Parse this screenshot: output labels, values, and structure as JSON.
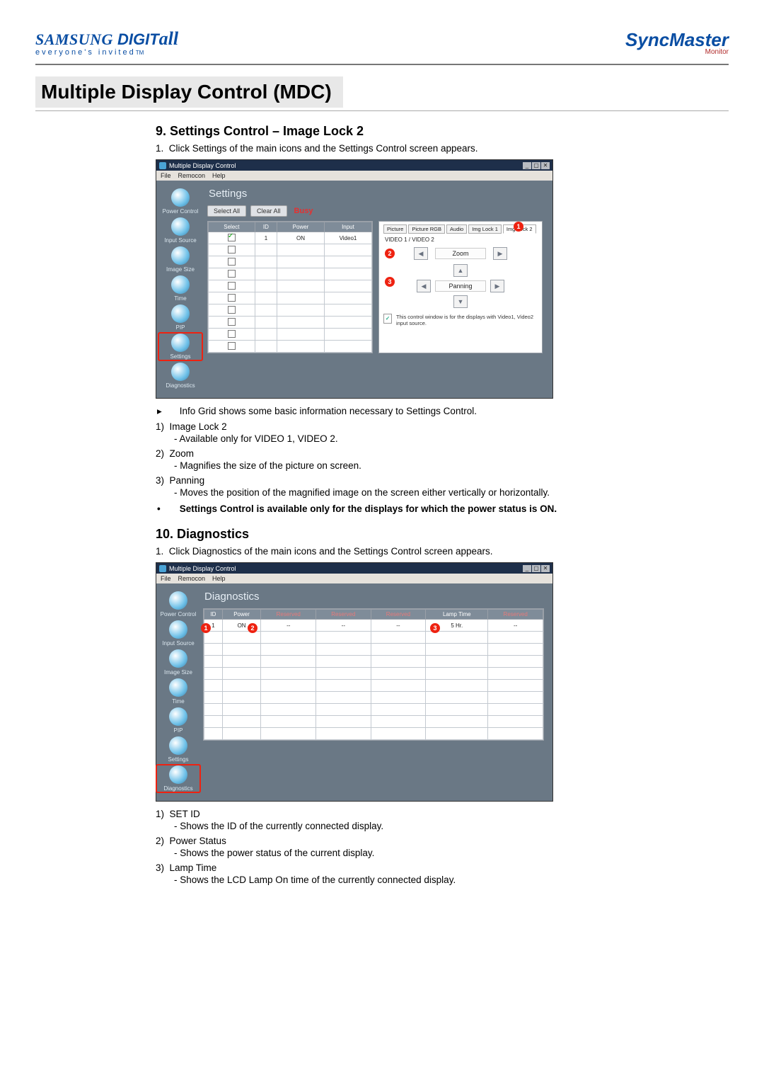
{
  "brand": {
    "left_prefix": "SAMSUNG",
    "left_mid": " DIGIT",
    "left_suffix": "all",
    "tagline": "everyone's invited",
    "tagline_tm": "TM",
    "right_main": "SyncMaster",
    "right_sub": "Monitor"
  },
  "page_title": "Multiple Display Control (MDC)",
  "section9": {
    "heading": "9. Settings Control – Image Lock 2",
    "intro_num": "1.",
    "intro_text": "Click Settings of the main icons and the Settings Control screen appears.",
    "info_line": "Info Grid shows some basic information necessary to Settings Control.",
    "items": [
      {
        "n": "1)",
        "title": "Image Lock 2",
        "desc": "- Available only for VIDEO 1, VIDEO 2."
      },
      {
        "n": "2)",
        "title": "Zoom",
        "desc": "- Magnifies the size of the picture on screen."
      },
      {
        "n": "3)",
        "title": "Panning",
        "desc": "- Moves the position of the magnified image on the screen either vertically or horizontally."
      }
    ],
    "bold_note": "Settings Control is available only for the displays for which the power status is ON."
  },
  "shot1": {
    "titlebar": "Multiple Display Control",
    "menu": [
      "File",
      "Remocon",
      "Help"
    ],
    "sidebar": [
      "Power Control",
      "Input Source",
      "Image Size",
      "Time",
      "PIP",
      "Settings",
      "Diagnostics"
    ],
    "selected_sidebar_index": 5,
    "screen_title": "Settings",
    "buttons": {
      "select_all": "Select All",
      "clear_all": "Clear All",
      "busy": "Busy"
    },
    "grid": {
      "headers": [
        "Select",
        "ID",
        "Power",
        "Input"
      ],
      "rows": [
        {
          "checked": true,
          "id": "1",
          "power": "ON",
          "input": "Video1"
        }
      ],
      "blank_rows": 9
    },
    "tabs": [
      "Picture",
      "Picture RGB",
      "Audio",
      "Img Lock 1",
      "Img Lock 2"
    ],
    "tabs_selected_index": 4,
    "subhead": "VIDEO 1 / VIDEO 2",
    "zoom_label": "Zoom",
    "panning_label": "Panning",
    "bubble1": "1",
    "bubble2": "2",
    "bubble3": "3",
    "hint": "This control window is for the displays with Video1, Video2 input source."
  },
  "section10": {
    "heading": "10. Diagnostics",
    "intro_num": "1.",
    "intro_text": "Click Diagnostics of the main icons and the Settings Control screen appears.",
    "items": [
      {
        "n": "1)",
        "title": "SET ID",
        "desc": "- Shows the ID of the currently connected display."
      },
      {
        "n": "2)",
        "title": "Power Status",
        "desc": "- Shows the power status of the current display."
      },
      {
        "n": "3)",
        "title": "Lamp Time",
        "desc": "- Shows the LCD Lamp On time of the currently connected display."
      }
    ]
  },
  "shot2": {
    "titlebar": "Multiple Display Control",
    "menu": [
      "File",
      "Remocon",
      "Help"
    ],
    "sidebar": [
      "Power Control",
      "Input Source",
      "Image Size",
      "Time",
      "PIP",
      "Settings",
      "Diagnostics"
    ],
    "selected_sidebar_index": 6,
    "screen_title": "Diagnostics",
    "grid": {
      "headers": [
        "ID",
        "Power",
        "Reserved",
        "Reserved",
        "Reserved",
        "Lamp Time",
        "Reserved"
      ],
      "row": {
        "id": "1",
        "power": "ON",
        "lamp": "5 Hr."
      },
      "blank_rows": 9
    },
    "bubble1": "1",
    "bubble2": "2",
    "bubble3": "3"
  }
}
